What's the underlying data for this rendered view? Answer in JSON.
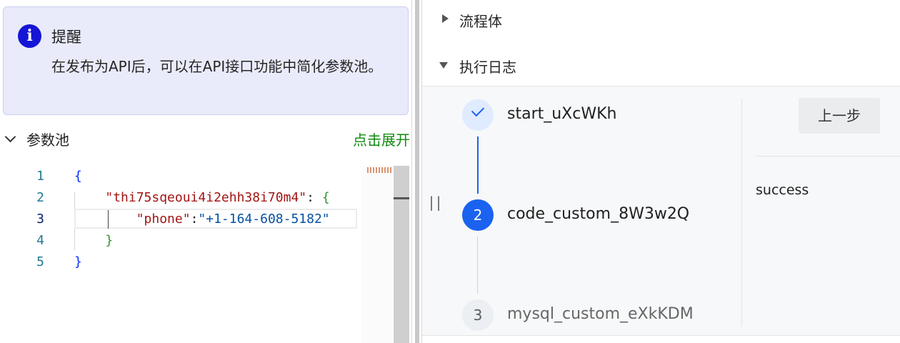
{
  "alert": {
    "icon": "info-icon",
    "title": "提醒",
    "message": "在发布为API后，可以在API接口功能中简化参数池。"
  },
  "param_pool": {
    "title": "参数池",
    "expand_label": "点击展开",
    "line_numbers": [
      "1",
      "2",
      "3",
      "4",
      "5"
    ],
    "code": {
      "open_brace": "{",
      "key1": "\"thi75sqeoui4i2ehh38i70m4\"",
      "colon": ": ",
      "inner_open": "{",
      "key2": "\"phone\"",
      "colon2": ":",
      "value2": "\"+1-164-608-5182\"",
      "inner_close": "}",
      "close_brace": "}"
    }
  },
  "sections": {
    "flow_body": "流程体",
    "exec_log": "执行日志"
  },
  "steps": [
    {
      "number": "",
      "name": "start_uXcWKh",
      "status": "done"
    },
    {
      "number": "2",
      "name": "code_custom_8W3w2Q",
      "status": "active"
    },
    {
      "number": "3",
      "name": "mysql_custom_eXkKDM",
      "status": "wait"
    }
  ],
  "handle_glyph": "||",
  "detail": {
    "prev_button": "上一步",
    "result": "success"
  },
  "colors": {
    "accent": "#1a62f0",
    "info": "#1515d6",
    "link_green": "#108a10"
  }
}
